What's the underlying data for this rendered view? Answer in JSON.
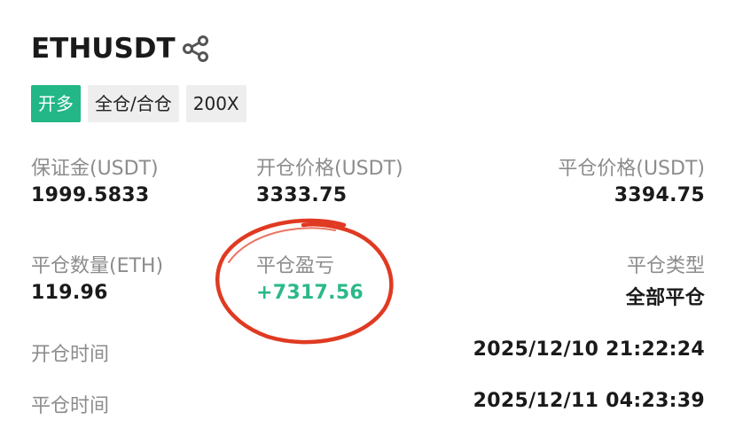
{
  "header": {
    "symbol": "ETHUSDT",
    "share_icon": "share-icon"
  },
  "badges": {
    "side": "开多",
    "margin_mode": "全仓/合仓",
    "leverage": "200X"
  },
  "fields": {
    "margin_label": "保证金(USDT)",
    "margin_value": "1999.5833",
    "open_price_label": "开仓价格(USDT)",
    "open_price_value": "3333.75",
    "close_price_label": "平仓价格(USDT)",
    "close_price_value": "3394.75",
    "close_qty_label": "平仓数量(ETH)",
    "close_qty_value": "119.96",
    "pnl_label": "平仓盈亏",
    "pnl_value": "+7317.56",
    "close_type_label": "平仓类型",
    "close_type_value": "全部平仓",
    "open_time_label": "开仓时间",
    "open_time_value": "2025/12/10 21:22:24",
    "close_time_label": "平仓时间",
    "close_time_value": "2025/12/11 04:23:39"
  },
  "colors": {
    "accent_green": "#23b787",
    "profit_green": "#2bb88a",
    "annotation_red": "#e03a22"
  }
}
